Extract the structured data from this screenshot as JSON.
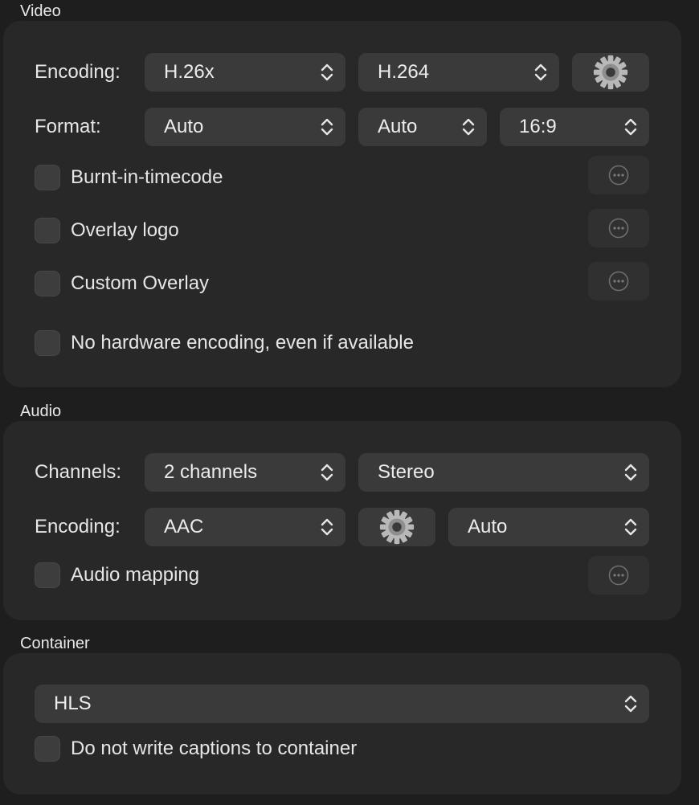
{
  "video": {
    "title": "Video",
    "encoding_label": "Encoding:",
    "encoding_family": "H.26x",
    "encoding_codec": "H.264",
    "format_label": "Format:",
    "format_value": "Auto",
    "format_size": "Auto",
    "format_aspect": "16:9",
    "burnt_in_timecode": "Burnt-in-timecode",
    "overlay_logo": "Overlay logo",
    "custom_overlay": "Custom Overlay",
    "no_hardware": "No hardware encoding, even if available"
  },
  "audio": {
    "title": "Audio",
    "channels_label": "Channels:",
    "channels_value": "2 channels",
    "channels_layout": "Stereo",
    "encoding_label": "Encoding:",
    "encoding_value": "AAC",
    "encoding_rate": "Auto",
    "audio_mapping": "Audio mapping"
  },
  "container": {
    "title": "Container",
    "format_value": "HLS",
    "no_captions": "Do not write captions to container"
  },
  "icons": {
    "settings": "gear-icon",
    "more": "ellipsis-circle-icon",
    "popup": "up-down-chevron-icon"
  }
}
